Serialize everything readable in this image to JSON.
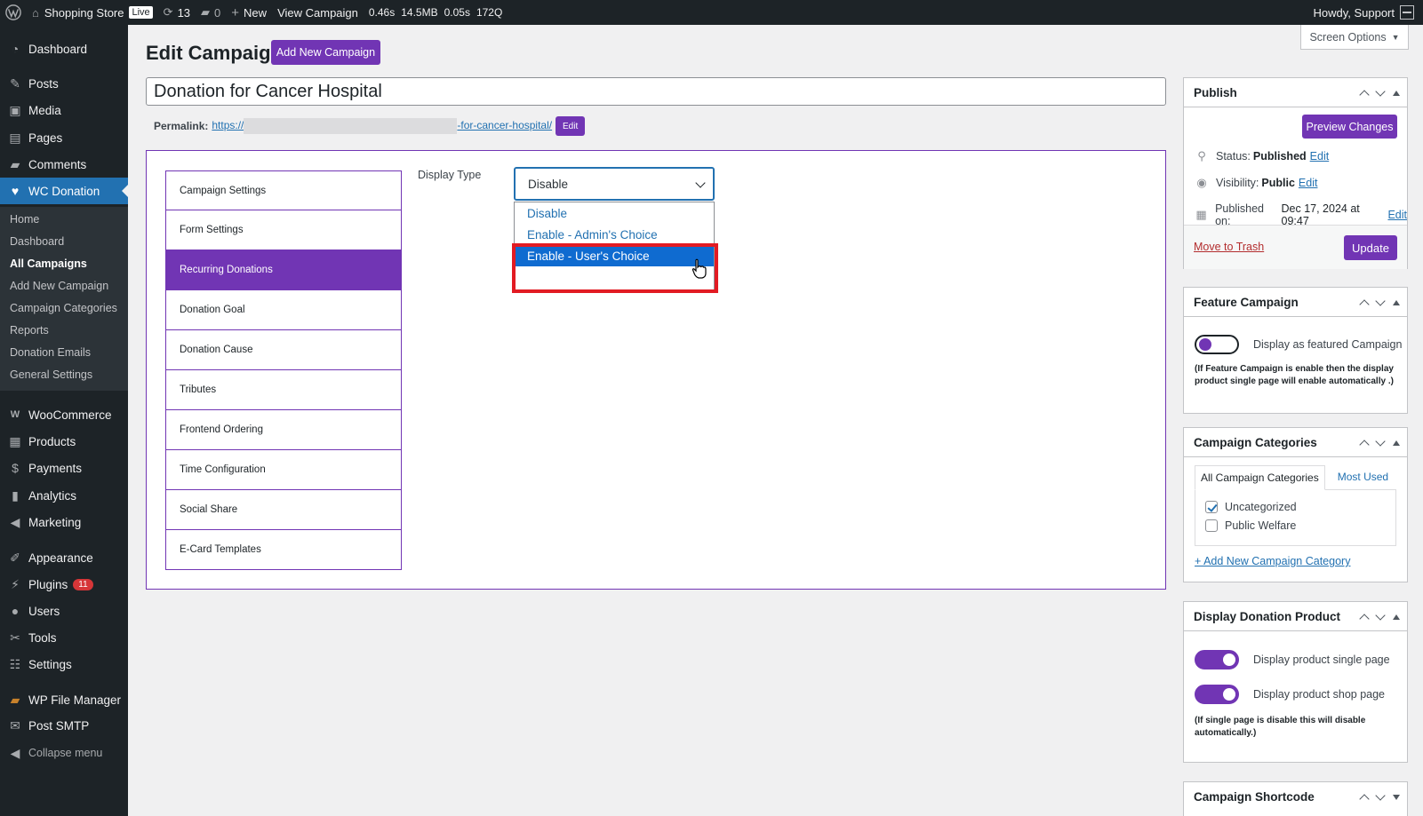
{
  "adminbar": {
    "site_name": "Shopping Store",
    "live_badge": "Live",
    "updates_count": "13",
    "comments_count": "0",
    "new_label": "New",
    "view_label": "View Campaign",
    "perf_time": "0.46s",
    "perf_mem": "14.5MB",
    "perf_q_time": "0.05s",
    "perf_queries": "172Q",
    "howdy": "Howdy, Support"
  },
  "sidebar": {
    "items": [
      {
        "label": "Dashboard",
        "icon": "dashboard-icon"
      },
      {
        "label": "Posts",
        "icon": "pin-icon"
      },
      {
        "label": "Media",
        "icon": "media-icon"
      },
      {
        "label": "Pages",
        "icon": "page-icon"
      },
      {
        "label": "Comments",
        "icon": "comment-icon"
      },
      {
        "label": "WC Donation",
        "icon": "heart-icon"
      },
      {
        "label": "WooCommerce",
        "icon": "woo-icon"
      },
      {
        "label": "Products",
        "icon": "archive-icon"
      },
      {
        "label": "Payments",
        "icon": "dollar-icon"
      },
      {
        "label": "Analytics",
        "icon": "chart-bar-icon"
      },
      {
        "label": "Marketing",
        "icon": "megaphone-icon"
      },
      {
        "label": "Appearance",
        "icon": "brush-icon"
      },
      {
        "label": "Plugins",
        "icon": "plugin-icon",
        "badge": "11"
      },
      {
        "label": "Users",
        "icon": "user-icon"
      },
      {
        "label": "Tools",
        "icon": "wrench-icon"
      },
      {
        "label": "Settings",
        "icon": "settings-icon"
      },
      {
        "label": "WP File Manager",
        "icon": "folder-icon"
      },
      {
        "label": "Post SMTP",
        "icon": "mail-icon"
      },
      {
        "label": "Collapse menu",
        "icon": "collapse-icon"
      }
    ],
    "submenu": [
      "Home",
      "Dashboard",
      "All Campaigns",
      "Add New Campaign",
      "Campaign Categories",
      "Reports",
      "Donation Emails",
      "General Settings"
    ]
  },
  "header": {
    "screen_options": "Screen Options",
    "title": "Edit Campaign",
    "add_new": "Add New Campaign",
    "campaign_title": "Donation for Cancer Hospital",
    "permalink_label": "Permalink:",
    "permalink_start": "https://",
    "permalink_end": "-for-cancer-hospital/",
    "permalink_edit": "Edit"
  },
  "tabs": [
    "Campaign Settings",
    "Form Settings",
    "Recurring Donations",
    "Donation Goal",
    "Donation Cause",
    "Tributes",
    "Frontend Ordering",
    "Time Configuration",
    "Social Share",
    "E-Card Templates"
  ],
  "recurring": {
    "display_type_label": "Display Type",
    "selected": "Disable",
    "options": [
      "Disable",
      "Enable - Admin's Choice",
      "Enable - User's Choice"
    ]
  },
  "publish": {
    "title": "Publish",
    "preview": "Preview Changes",
    "status_label": "Status:",
    "status_value": "Published",
    "visibility_label": "Visibility:",
    "visibility_value": "Public",
    "published_label": "Published on:",
    "published_value": "Dec 17, 2024 at 09:47",
    "edit": "Edit",
    "trash": "Move to Trash",
    "update": "Update"
  },
  "feature": {
    "title": "Feature Campaign",
    "toggle_label": "Display as featured Campaign",
    "note": "(If Feature Campaign is enable then the display product single page will enable automatically .)"
  },
  "categories": {
    "title": "Campaign Categories",
    "tab_all": "All Campaign Categories",
    "tab_used": "Most Used",
    "items": [
      "Uncategorized",
      "Public Welfare"
    ],
    "add_link": "+ Add New Campaign Category"
  },
  "display_product": {
    "title": "Display Donation Product",
    "single": "Display product single page",
    "shop": "Display product shop page",
    "note": "(If single page is disable this will disable automatically.)"
  },
  "shortcode": {
    "title": "Campaign Shortcode"
  },
  "colors": {
    "accent": "#7135b4",
    "admin_blue": "#2271b1",
    "highlight_red": "#e21b23"
  }
}
